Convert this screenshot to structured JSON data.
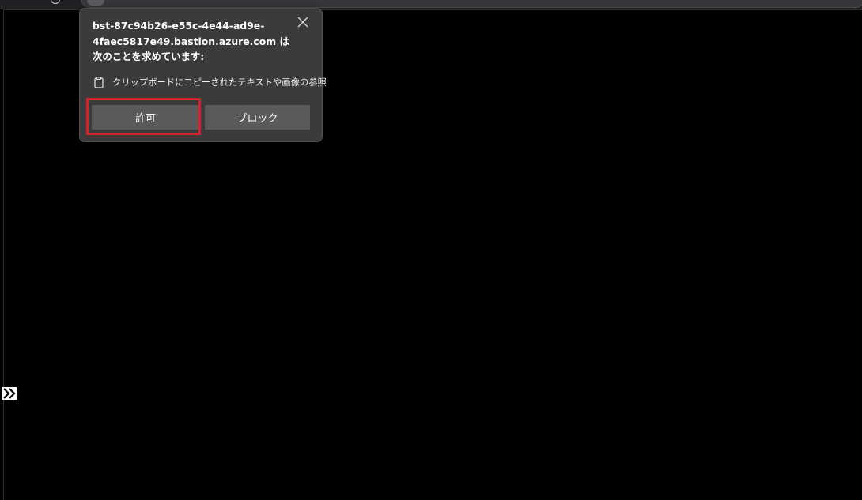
{
  "permission_prompt": {
    "title": "bst-87c94b26-e55c-4e44-ad9e-4faec5817e49.bastion.azure.com は次のことを求めています:",
    "permission_icon": "clipboard-icon",
    "permission_text": "クリップボードにコピーされたテキストや画像の参照",
    "allow_label": "許可",
    "block_label": "ブロック",
    "close_icon": "close-icon"
  },
  "page": {
    "side_toggle_icon": "chevron-right-double-icon"
  },
  "colors": {
    "popup_background": "#3b3b3b",
    "button_background": "#5a5a5a",
    "highlight": "#d4242b",
    "page_background": "#000000"
  }
}
